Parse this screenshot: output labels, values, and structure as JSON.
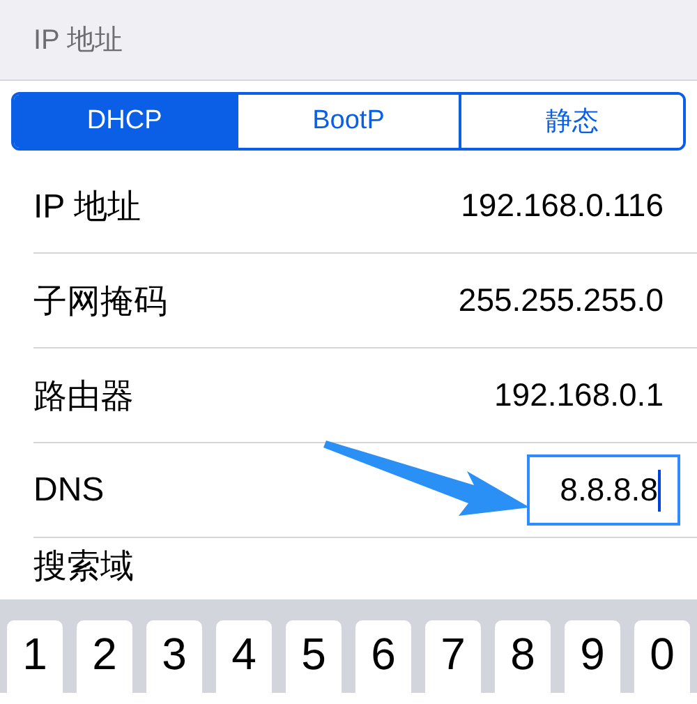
{
  "section_header": "IP 地址",
  "segments": [
    {
      "label": "DHCP",
      "selected": true
    },
    {
      "label": "BootP",
      "selected": false
    },
    {
      "label": "静态",
      "selected": false
    }
  ],
  "rows": [
    {
      "kind": "value",
      "label": "IP 地址",
      "value": "192.168.0.116"
    },
    {
      "kind": "value",
      "label": "子网掩码",
      "value": "255.255.255.0"
    },
    {
      "kind": "value",
      "label": "路由器",
      "value": "192.168.0.1"
    },
    {
      "kind": "field",
      "label": "DNS",
      "value": "8.8.8.8"
    },
    {
      "kind": "value",
      "label": "搜索域"
    }
  ],
  "keyboard": {
    "keys": [
      "1",
      "2",
      "3",
      "4",
      "5",
      "6",
      "7",
      "8",
      "9",
      "0"
    ]
  }
}
